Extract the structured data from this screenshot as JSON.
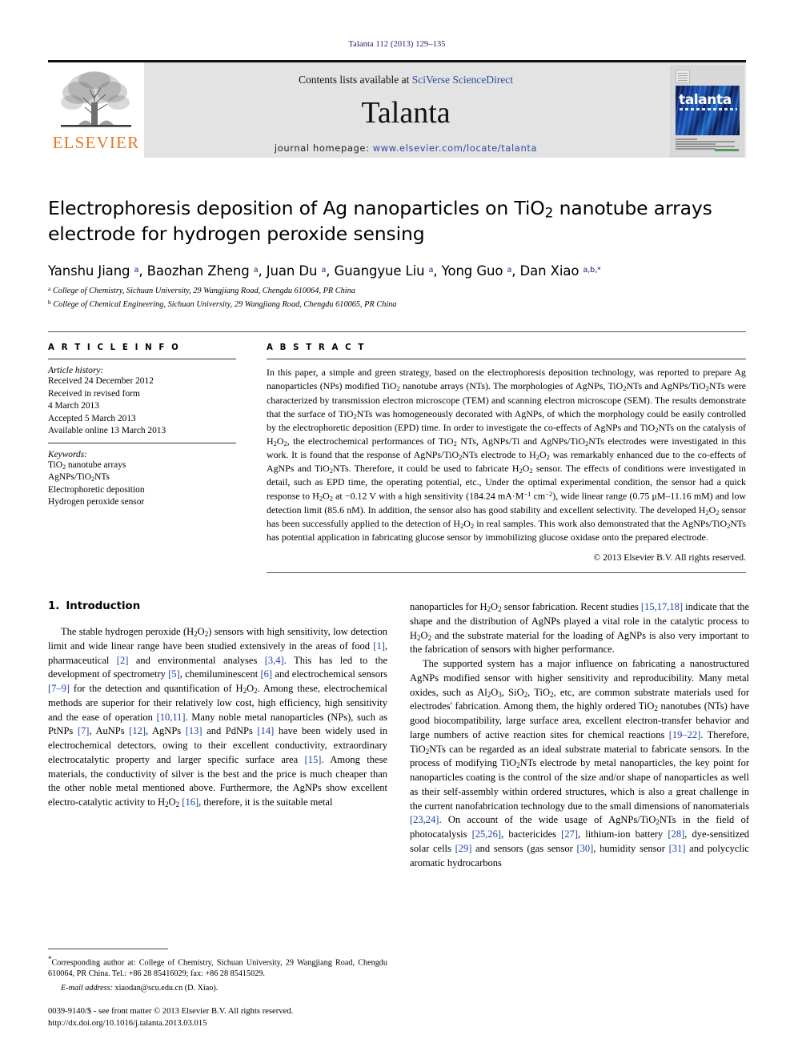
{
  "running_head": "Talanta 112 (2013) 129–135",
  "masthead": {
    "publisher_name": "ELSEVIER",
    "contents_prefix": "Contents lists available at ",
    "sciencedirect": "SciVerse ScienceDirect",
    "journal_name": "Talanta",
    "homepage_prefix": "journal homepage: ",
    "homepage_url": "www.elsevier.com/locate/talanta",
    "cover_title": "talanta",
    "accent_orange": "#E87722",
    "link_blue": "#2e4a9e",
    "band_gray": "#e3e3e3"
  },
  "article": {
    "title_line1": "Electrophoresis deposition of Ag nanoparticles on TiO",
    "title_line1_sub": "2",
    "title_line1_end": " nanotube arrays",
    "title_line2": "electrode for hydrogen peroxide sensing",
    "authors_plain": "Yanshu Jiang a, Baozhan Zheng a, Juan Du a, Guangyue Liu a, Yong Guo a, Dan Xiao a,b,*",
    "affiliation_a": "College of Chemistry, Sichuan University, 29 Wangjiang Road, Chengdu 610064, PR China",
    "affiliation_b": "College of Chemical Engineering, Sichuan University, 29 Wangjiang Road, Chengdu 610065, PR China"
  },
  "article_info": {
    "label": "A R T I C L E  I N F O",
    "history_title": "Article history:",
    "history": [
      "Received 24 December 2012",
      "Received in revised form",
      "4 March 2013",
      "Accepted 5 March 2013",
      "Available online 13 March 2013"
    ],
    "keywords_title": "Keywords:",
    "keywords": [
      "TiO2 nanotube arrays",
      "AgNPs/TiO2NTs",
      "Electrophoretic deposition",
      "Hydrogen peroxide sensor"
    ]
  },
  "abstract": {
    "label": "A B S T R A C T",
    "text": "In this paper, a simple and green strategy, based on the electrophoresis deposition technology, was reported to prepare Ag nanoparticles (NPs) modified TiO2 nanotube arrays (NTs). The morphologies of AgNPs, TiO2NTs and AgNPs/TiO2NTs were characterized by transmission electron microscope (TEM) and scanning electron microscope (SEM). The results demonstrate that the surface of TiO2NTs was homogeneously decorated with AgNPs, of which the morphology could be easily controlled by the electrophoretic deposition (EPD) time. In order to investigate the co-effects of AgNPs and TiO2NTs on the catalysis of H2O2, the electrochemical performances of TiO2 NTs, AgNPs/Ti and AgNPs/TiO2NTs electrodes were investigated in this work. It is found that the response of AgNPs/TiO2NTs electrode to H2O2 was remarkably enhanced due to the co-effects of AgNPs and TiO2NTs. Therefore, it could be used to fabricate H2O2 sensor. The effects of conditions were investigated in detail, such as EPD time, the operating potential, etc., Under the optimal experimental condition, the sensor had a quick response to H2O2 at −0.12 V with a high sensitivity (184.24 mA·M−1 cm−2), wide linear range (0.75 μM–11.16 mM) and low detection limit (85.6 nM). In addition, the sensor also has good stability and excellent selectivity. The developed H2O2 sensor has been successfully applied to the detection of H2O2 in real samples. This work also demonstrated that the AgNPs/TiO2NTs has potential application in fabricating glucose sensor by immobilizing glucose oxidase onto the prepared electrode.",
    "copyright": "© 2013 Elsevier B.V. All rights reserved."
  },
  "sections": {
    "intro_number": "1.",
    "intro_title": "Introduction",
    "left_paragraphs": [
      "The stable hydrogen peroxide (H2O2) sensors with high sensitivity, low detection limit and wide linear range have been studied extensively in the areas of food [1], pharmaceutical [2] and environmental analyses [3,4]. This has led to the development of spectrometry [5], chemiluminescent [6] and electrochemical sensors [7–9] for the detection and quantification of H2O2. Among these, electrochemical methods are superior for their relatively low cost, high efficiency, high sensitivity and the ease of operation [10,11]. Many noble metal nanoparticles (NPs), such as PtNPs [7], AuNPs [12], AgNPs [13] and PdNPs [14] have been widely used in electrochemical detectors, owing to their excellent conductivity, extraordinary electrocatalytic property and larger specific surface area [15]. Among these materials, the conductivity of silver is the best and the price is much cheaper than the other noble metal mentioned above. Furthermore, the AgNPs show excellent electro-catalytic activity to H2O2 [16], therefore, it is the suitable metal"
    ],
    "right_paragraphs": [
      "nanoparticles for H2O2 sensor fabrication. Recent studies [15,17,18] indicate that the shape and the distribution of AgNPs played a vital role in the catalytic process to H2O2 and the substrate material for the loading of AgNPs is also very important to the fabrication of sensors with higher performance.",
      "The supported system has a major influence on fabricating a nanostructured AgNPs modified sensor with higher sensitivity and reproducibility. Many metal oxides, such as Al2O3, SiO2, TiO2, etc, are common substrate materials used for electrodes' fabrication. Among them, the highly ordered TiO2 nanotubes (NTs) have good biocompatibility, large surface area, excellent electron-transfer behavior and large numbers of active reaction sites for chemical reactions [19–22]. Therefore, TiO2NTs can be regarded as an ideal substrate material to fabricate sensors. In the process of modifying TiO2NTs electrode by metal nanoparticles, the key point for nanoparticles coating is the control of the size and/or shape of nanoparticles as well as their self-assembly within ordered structures, which is also a great challenge in the current nanofabrication technology due to the small dimensions of nanomaterials [23,24]. On account of the wide usage of AgNPs/TiO2NTs in the field of photocatalysis [25,26], bactericides [27], lithium-ion battery [28], dye-sensitized solar cells [29] and sensors (gas sensor [30], humidity sensor [31] and polycyclic aromatic hydrocarbons"
    ]
  },
  "footnote": {
    "corresponding": "Corresponding author at: College of Chemistry, Sichuan University, 29 Wangjiang Road, Chengdu 610064, PR China. Tel.: +86 28 85416029; fax: +86 28 85415029.",
    "email_label": "E-mail address:",
    "email_value": "xiaodan@scu.edu.cn (D. Xiao).",
    "issn_line": "0039-9140/$ - see front matter © 2013 Elsevier B.V. All rights reserved.",
    "doi_line": "http://dx.doi.org/10.1016/j.talanta.2013.03.015"
  }
}
